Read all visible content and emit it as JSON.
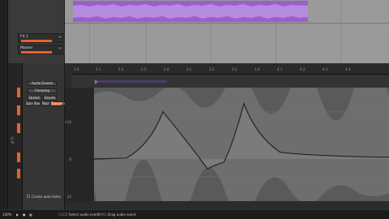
{
  "tracks": [
    {
      "name": "FX 1"
    },
    {
      "name": "Master"
    }
  ],
  "editor": {
    "buttons": {
      "audio_events": "Audio Events",
      "comping": "Comping",
      "stretch": "Stretch",
      "onsets": "Onsets",
      "gain": "Gain",
      "pan": "Pan",
      "pitch": "Pitch",
      "transient": "Transient"
    },
    "side_tab": "CLIP",
    "create_fades": "Create auto-fades",
    "ruler": [
      "1.4",
      "2.1",
      "2.2",
      "2.3",
      "2.4",
      "3.1",
      "3.2",
      "3.3",
      "3.4",
      "4.1",
      "4.2",
      "4.3",
      "4.4"
    ],
    "scale": [
      "+12",
      "0",
      "-12"
    ]
  },
  "status": {
    "zoom": "100%",
    "click_key": "CLICK",
    "click_action": "Select audio event",
    "drag_key": "DRAG",
    "drag_action": "Drag audio event"
  },
  "colors": {
    "accent": "#e8622a",
    "clip": "#9c5ec8"
  }
}
